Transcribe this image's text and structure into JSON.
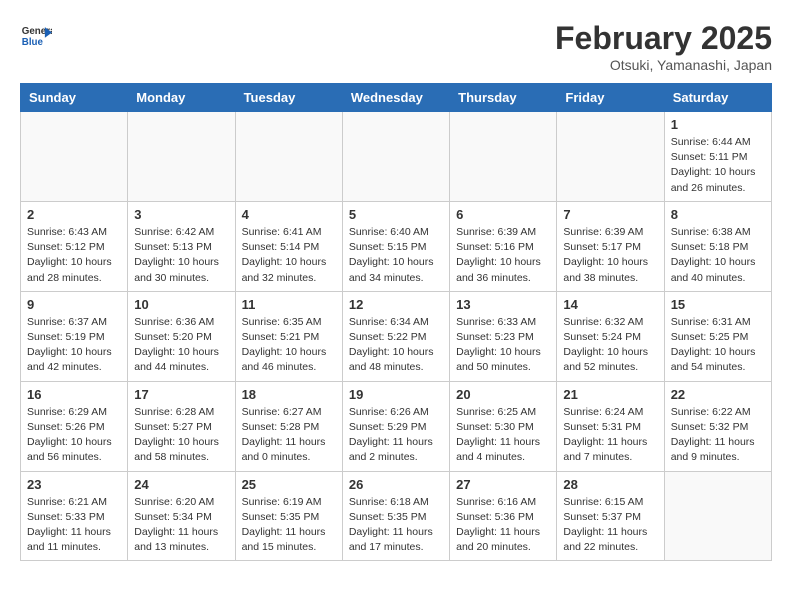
{
  "header": {
    "logo_line1": "General",
    "logo_line2": "Blue",
    "title": "February 2025",
    "subtitle": "Otsuki, Yamanashi, Japan"
  },
  "weekdays": [
    "Sunday",
    "Monday",
    "Tuesday",
    "Wednesday",
    "Thursday",
    "Friday",
    "Saturday"
  ],
  "weeks": [
    [
      {
        "day": "",
        "info": ""
      },
      {
        "day": "",
        "info": ""
      },
      {
        "day": "",
        "info": ""
      },
      {
        "day": "",
        "info": ""
      },
      {
        "day": "",
        "info": ""
      },
      {
        "day": "",
        "info": ""
      },
      {
        "day": "1",
        "info": "Sunrise: 6:44 AM\nSunset: 5:11 PM\nDaylight: 10 hours\nand 26 minutes."
      }
    ],
    [
      {
        "day": "2",
        "info": "Sunrise: 6:43 AM\nSunset: 5:12 PM\nDaylight: 10 hours\nand 28 minutes."
      },
      {
        "day": "3",
        "info": "Sunrise: 6:42 AM\nSunset: 5:13 PM\nDaylight: 10 hours\nand 30 minutes."
      },
      {
        "day": "4",
        "info": "Sunrise: 6:41 AM\nSunset: 5:14 PM\nDaylight: 10 hours\nand 32 minutes."
      },
      {
        "day": "5",
        "info": "Sunrise: 6:40 AM\nSunset: 5:15 PM\nDaylight: 10 hours\nand 34 minutes."
      },
      {
        "day": "6",
        "info": "Sunrise: 6:39 AM\nSunset: 5:16 PM\nDaylight: 10 hours\nand 36 minutes."
      },
      {
        "day": "7",
        "info": "Sunrise: 6:39 AM\nSunset: 5:17 PM\nDaylight: 10 hours\nand 38 minutes."
      },
      {
        "day": "8",
        "info": "Sunrise: 6:38 AM\nSunset: 5:18 PM\nDaylight: 10 hours\nand 40 minutes."
      }
    ],
    [
      {
        "day": "9",
        "info": "Sunrise: 6:37 AM\nSunset: 5:19 PM\nDaylight: 10 hours\nand 42 minutes."
      },
      {
        "day": "10",
        "info": "Sunrise: 6:36 AM\nSunset: 5:20 PM\nDaylight: 10 hours\nand 44 minutes."
      },
      {
        "day": "11",
        "info": "Sunrise: 6:35 AM\nSunset: 5:21 PM\nDaylight: 10 hours\nand 46 minutes."
      },
      {
        "day": "12",
        "info": "Sunrise: 6:34 AM\nSunset: 5:22 PM\nDaylight: 10 hours\nand 48 minutes."
      },
      {
        "day": "13",
        "info": "Sunrise: 6:33 AM\nSunset: 5:23 PM\nDaylight: 10 hours\nand 50 minutes."
      },
      {
        "day": "14",
        "info": "Sunrise: 6:32 AM\nSunset: 5:24 PM\nDaylight: 10 hours\nand 52 minutes."
      },
      {
        "day": "15",
        "info": "Sunrise: 6:31 AM\nSunset: 5:25 PM\nDaylight: 10 hours\nand 54 minutes."
      }
    ],
    [
      {
        "day": "16",
        "info": "Sunrise: 6:29 AM\nSunset: 5:26 PM\nDaylight: 10 hours\nand 56 minutes."
      },
      {
        "day": "17",
        "info": "Sunrise: 6:28 AM\nSunset: 5:27 PM\nDaylight: 10 hours\nand 58 minutes."
      },
      {
        "day": "18",
        "info": "Sunrise: 6:27 AM\nSunset: 5:28 PM\nDaylight: 11 hours\nand 0 minutes."
      },
      {
        "day": "19",
        "info": "Sunrise: 6:26 AM\nSunset: 5:29 PM\nDaylight: 11 hours\nand 2 minutes."
      },
      {
        "day": "20",
        "info": "Sunrise: 6:25 AM\nSunset: 5:30 PM\nDaylight: 11 hours\nand 4 minutes."
      },
      {
        "day": "21",
        "info": "Sunrise: 6:24 AM\nSunset: 5:31 PM\nDaylight: 11 hours\nand 7 minutes."
      },
      {
        "day": "22",
        "info": "Sunrise: 6:22 AM\nSunset: 5:32 PM\nDaylight: 11 hours\nand 9 minutes."
      }
    ],
    [
      {
        "day": "23",
        "info": "Sunrise: 6:21 AM\nSunset: 5:33 PM\nDaylight: 11 hours\nand 11 minutes."
      },
      {
        "day": "24",
        "info": "Sunrise: 6:20 AM\nSunset: 5:34 PM\nDaylight: 11 hours\nand 13 minutes."
      },
      {
        "day": "25",
        "info": "Sunrise: 6:19 AM\nSunset: 5:35 PM\nDaylight: 11 hours\nand 15 minutes."
      },
      {
        "day": "26",
        "info": "Sunrise: 6:18 AM\nSunset: 5:35 PM\nDaylight: 11 hours\nand 17 minutes."
      },
      {
        "day": "27",
        "info": "Sunrise: 6:16 AM\nSunset: 5:36 PM\nDaylight: 11 hours\nand 20 minutes."
      },
      {
        "day": "28",
        "info": "Sunrise: 6:15 AM\nSunset: 5:37 PM\nDaylight: 11 hours\nand 22 minutes."
      },
      {
        "day": "",
        "info": ""
      }
    ]
  ]
}
